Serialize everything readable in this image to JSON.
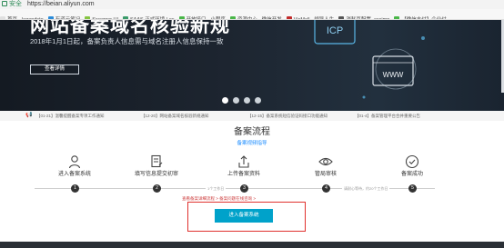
{
  "browser": {
    "secure_label": "安全",
    "url": "https://beian.aliyun.com",
    "bookmarks": [
      {
        "label": "首页 - legendsto",
        "color": "#e0e0e0"
      },
      {
        "label": "有道云笔记",
        "color": "#2a8bd8"
      },
      {
        "label": "Swagger UI",
        "color": "#85c441"
      },
      {
        "label": "SAAS 正式环境 | ex",
        "color": "#3a9b6a"
      },
      {
        "label": "开放接口 - 小程序",
        "color": "#49b648"
      },
      {
        "label": "资源中心 - 微信开发",
        "color": "#49b648"
      },
      {
        "label": "VisMall - 领导人生",
        "color": "#c12b2b"
      },
      {
        "label": "消耗页配置_assimp",
        "color": "#555555"
      },
      {
        "label": "【微信支付】企业付",
        "color": "#49b648"
      }
    ]
  },
  "hero": {
    "title": "网站备案域名核验新规",
    "subtitle": "2018年1月1日起，备案负责人信息需与域名注册人信息保持一致",
    "button": "查看详情",
    "icp": "ICP",
    "www": "WWW",
    "slides": 4,
    "active_slide": 0
  },
  "notices": [
    "【01-21】温馨提醒备案专项工作通知",
    "【12-20】网站备案域名核验新规通知",
    "【12-15】备案系统短信验证码接口功能通知",
    "【01-4】备案管理平台合并重要公告"
  ],
  "process": {
    "title": "备案流程",
    "subtitle": "备案视频指导",
    "steps": [
      {
        "label": "进入备案系统",
        "num": "1",
        "icon": "person-icon"
      },
      {
        "label": "填写信息提交初审",
        "num": "2",
        "icon": "form-icon"
      },
      {
        "label": "上传备案资料",
        "num": "3",
        "icon": "upload-icon"
      },
      {
        "label": "管局审核",
        "num": "4",
        "icon": "eye-icon"
      },
      {
        "label": "备案成功",
        "num": "5",
        "icon": "check-icon"
      }
    ],
    "durations": [
      "1个工作日",
      "请耐心等待，约20个工作日"
    ],
    "links": "查看备案详细流程 >   备案问题在线咨询 >",
    "enter_button": "进入备案系统"
  }
}
